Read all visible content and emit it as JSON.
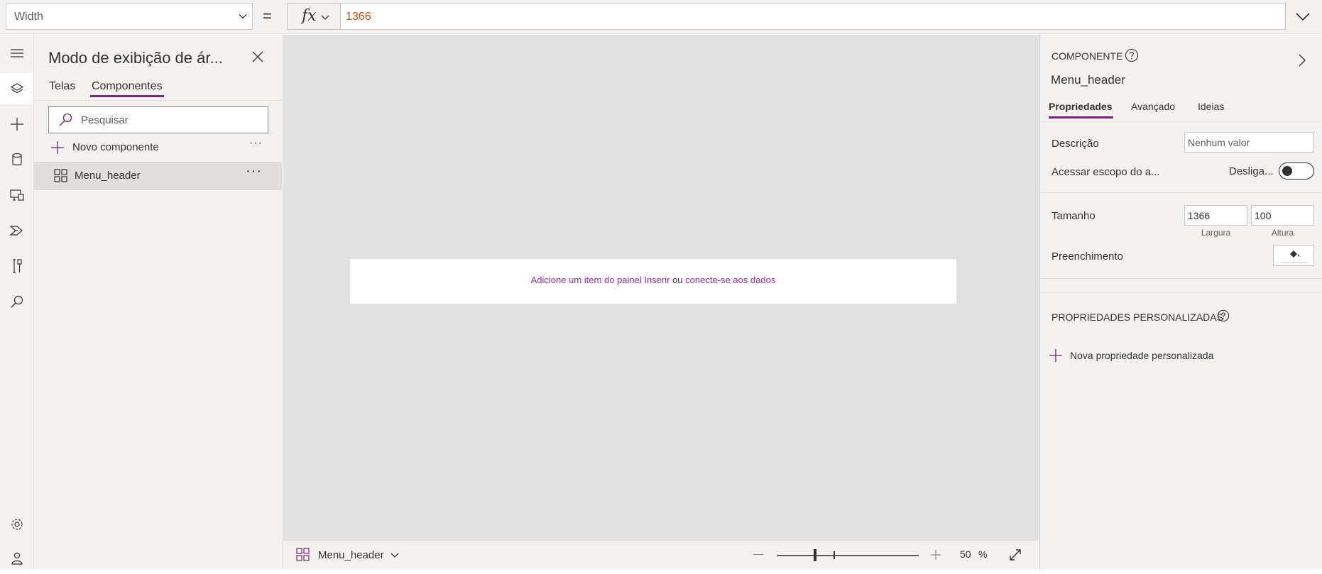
{
  "formula_bar": {
    "property": "Width",
    "equals": "=",
    "fx": "fx",
    "formula": "1366"
  },
  "left_rail": {
    "items": [
      "hamburger-icon",
      "layers-icon",
      "plus-icon",
      "database-icon",
      "media-icon",
      "power-automate-icon",
      "tools-icon",
      "search-icon",
      "gear-icon",
      "virtual-agent-icon"
    ]
  },
  "tree_panel": {
    "title": "Modo de exibição de ár...",
    "tabs": [
      "Telas",
      "Componentes"
    ],
    "active_tab": "Componentes",
    "search_placeholder": "Pesquisar",
    "new_component": "Novo componente",
    "components": [
      {
        "name": "Menu_header",
        "selected": true
      }
    ],
    "more": "···"
  },
  "canvas": {
    "hint_link1": "Adicione um item do painel Inserir",
    "hint_or": " ou ",
    "hint_link2": "conecte-se aos dados",
    "link_color": "#9b2ea0"
  },
  "status_bar": {
    "component": "Menu_header",
    "zoom": "50",
    "zoom_unit": "%",
    "zoom_level": 0.5
  },
  "properties_panel": {
    "label": "COMPONENTE",
    "name": "Menu_header",
    "tabs": [
      "Propriedades",
      "Avançado",
      "Ideias"
    ],
    "active_tab": "Propriedades",
    "description_label": "Descrição",
    "description_placeholder": "Nenhum valor",
    "scope_label": "Acessar escopo do a...",
    "scope_state": "Desliga...",
    "scope_on": false,
    "size_label": "Tamanho",
    "width": "1366",
    "height": "100",
    "width_caption": "Largura",
    "height_caption": "Altura",
    "fill_label": "Preenchimento",
    "custom_props_label": "PROPRIEDADES PERSONALIZADAS",
    "new_custom_prop": "Nova propriedade personalizada"
  },
  "colors": {
    "accent": "#742774",
    "formula_value": "#ca5010",
    "canvas_bg": "#e1e1e1",
    "panel_bg": "#f3f2f1"
  }
}
